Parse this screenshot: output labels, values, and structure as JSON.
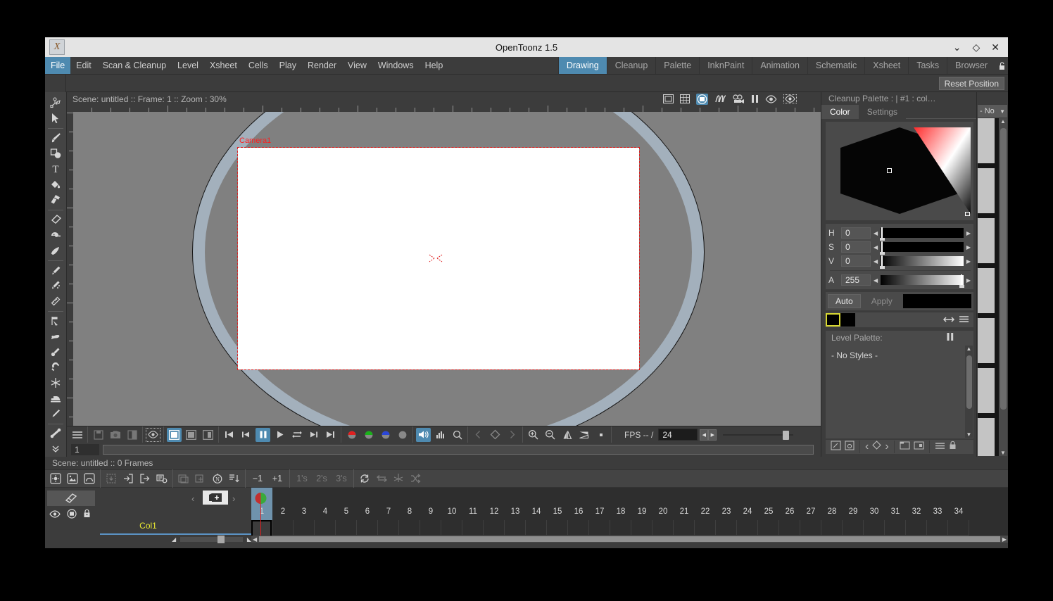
{
  "window": {
    "title": "OpenToonz 1.5",
    "app_icon": "x-logo-icon",
    "minimize": "⌄",
    "maximize": "◇",
    "close": "✕"
  },
  "menubar": {
    "items": [
      {
        "label": "File",
        "active": true
      },
      {
        "label": "Edit",
        "active": false
      },
      {
        "label": "Scan & Cleanup",
        "active": false
      },
      {
        "label": "Level",
        "active": false
      },
      {
        "label": "Xsheet",
        "active": false
      },
      {
        "label": "Cells",
        "active": false
      },
      {
        "label": "Play",
        "active": false
      },
      {
        "label": "Render",
        "active": false
      },
      {
        "label": "View",
        "active": false
      },
      {
        "label": "Windows",
        "active": false
      },
      {
        "label": "Help",
        "active": false
      }
    ],
    "rooms": [
      {
        "label": "Drawing",
        "active": true
      },
      {
        "label": "Cleanup",
        "active": false
      },
      {
        "label": "Palette",
        "active": false
      },
      {
        "label": "InknPaint",
        "active": false
      },
      {
        "label": "Animation",
        "active": false
      },
      {
        "label": "Schematic",
        "active": false
      },
      {
        "label": "Xsheet",
        "active": false
      },
      {
        "label": "Tasks",
        "active": false
      },
      {
        "label": "Browser",
        "active": false
      }
    ],
    "lock_icon": "unlock-icon"
  },
  "toolbar": {
    "reset_position": "Reset Position"
  },
  "tools": [
    {
      "name": "animate-tool"
    },
    {
      "name": "selection-tool"
    },
    {
      "name": "brush-tool"
    },
    {
      "name": "geometric-tool"
    },
    {
      "name": "type-tool"
    },
    {
      "name": "fill-tool"
    },
    {
      "name": "paintbrush-tool"
    },
    {
      "name": "eraser-tool"
    },
    {
      "name": "tape-tool"
    },
    {
      "name": "style-picker-tool"
    },
    {
      "name": "rgb-picker-tool"
    },
    {
      "name": "ruler-tool"
    },
    {
      "name": "control-point-editor-tool"
    },
    {
      "name": "pinch-tool"
    },
    {
      "name": "pump-tool"
    },
    {
      "name": "magnet-tool"
    },
    {
      "name": "bender-tool"
    },
    {
      "name": "iron-tool"
    },
    {
      "name": "cutter-tool"
    },
    {
      "name": "skeleton-tool"
    },
    {
      "name": "more-tools-icon"
    }
  ],
  "viewer": {
    "status": "Scene: untitled   ::   Frame: 1  ::  Zoom : 30%",
    "camera_label": "Camera1",
    "icons": [
      {
        "name": "safe-area-icon",
        "state": "off"
      },
      {
        "name": "field-guide-icon",
        "state": "off"
      },
      {
        "name": "camera-view-icon",
        "state": "on"
      },
      {
        "name": "3d-view-icon",
        "state": "off"
      },
      {
        "name": "camera-test-icon",
        "state": "off"
      },
      {
        "name": "freeze-icon",
        "state": "off"
      },
      {
        "name": "preview-icon",
        "state": "off"
      },
      {
        "name": "sub-camera-preview-icon",
        "state": "off"
      }
    ],
    "colors": {
      "background": "#808080",
      "table": "#a3b0bc",
      "camera_fill": "#ffffff",
      "camera_border": "#e02020",
      "label": "#ff1d1d"
    }
  },
  "playback": {
    "groups": [
      [
        "hamburger-menu-icon"
      ],
      [
        "save-image-icon",
        "snapshot-icon",
        "compare-icon"
      ],
      [
        "define-subcamera-icon"
      ],
      [
        "view-mode-full-icon",
        "view-mode-half-icon",
        "view-mode-side-icon"
      ],
      [
        "first-frame-icon",
        "prev-frame-icon",
        "pause-icon",
        "play-icon",
        "loop-icon",
        "next-frame-icon",
        "last-frame-icon"
      ],
      [
        "channel-red-icon",
        "channel-green-icon",
        "channel-blue-icon",
        "channel-matte-icon"
      ],
      [
        "sound-icon",
        "histogram-icon",
        "zoom-tool-icon"
      ],
      [
        "prev-key-icon",
        "set-key-icon",
        "next-key-icon"
      ],
      [
        "zoom-in-icon",
        "zoom-out-icon",
        "flip-horizontal-icon",
        "flip-vertical-icon",
        "reset-view-icon"
      ]
    ],
    "fps_label": "FPS -- /",
    "fps_value": "24",
    "pause_active": true,
    "sound_active": true
  },
  "frame_slider": {
    "value": "1"
  },
  "color_editor": {
    "panel_title": "Cleanup Palette :  | #1 : col…",
    "tabs": [
      {
        "label": "Color",
        "active": true
      },
      {
        "label": "Settings",
        "active": false
      }
    ],
    "channels": [
      {
        "label": "H",
        "value": "0"
      },
      {
        "label": "S",
        "value": "0"
      },
      {
        "label": "V",
        "value": "0"
      },
      {
        "label": "A",
        "value": "255"
      }
    ],
    "auto_label": "Auto",
    "apply_label": "Apply",
    "current_color": "#000000",
    "swatch_outline": "#d7d732",
    "icons": [
      "swap-colors-icon",
      "options-menu-icon"
    ]
  },
  "level_palette": {
    "title": "Level Palette:",
    "pause_icon": "freeze-icon",
    "empty_text": "- No Styles -",
    "tools": [
      "new-style-icon",
      "save-palette-icon",
      "prev-key-icon",
      "set-key-icon",
      "next-key-icon",
      "new-page-icon",
      "new-style-page-icon",
      "options-menu-icon",
      "lock-palette-icon"
    ]
  },
  "right_strip": {
    "combo_label": "- No",
    "chip_color": "#c4c4c4"
  },
  "xsheet": {
    "status": "Scene: untitled   ::   0 Frames",
    "toolbar_groups": [
      [
        "new-vector-level-icon",
        "new-toonz-raster-level-icon",
        "new-raster-level-icon"
      ],
      [
        "load-level-icon",
        "save-level-icon",
        "export-level-icon",
        "scan-settings-icon"
      ],
      [
        "duplicate-drawing-icon",
        "merge-cells-icon",
        "autorenumber-icon",
        "reframe-icon"
      ],
      [
        "minus-one-label",
        "plus-one-label"
      ],
      [
        "ones-label",
        "twos-label",
        "threes-label"
      ],
      [
        "repeat-icon",
        "swing-icon",
        "random-icon",
        "step-shuffle-icon"
      ]
    ],
    "toolbar_text": {
      "minus_one": "−1",
      "plus_one": "+1",
      "ones": "1's",
      "twos": "2's",
      "threes": "3's"
    },
    "level_strip_icon": "toggle-level-strip-icon",
    "new_level_icon": "new-level-icon",
    "nav_prev": "‹",
    "nav_next": "›",
    "frame_mode": "Frame",
    "column_header_icons": [
      "eye-icon",
      "camstand-icon",
      "lock-icon"
    ],
    "column_name": "Col1",
    "current_frame": 1,
    "frames": [
      1,
      2,
      3,
      4,
      5,
      6,
      7,
      8,
      9,
      10,
      11,
      12,
      13,
      14,
      15,
      16,
      17,
      18,
      19,
      20,
      21,
      22,
      23,
      24,
      25,
      26,
      27,
      28,
      29,
      30,
      31,
      32,
      33,
      34
    ],
    "onion_marker": {
      "left_color": "#c23030",
      "right_color": "#3aa93a"
    },
    "playhead_color": "#e02020"
  }
}
